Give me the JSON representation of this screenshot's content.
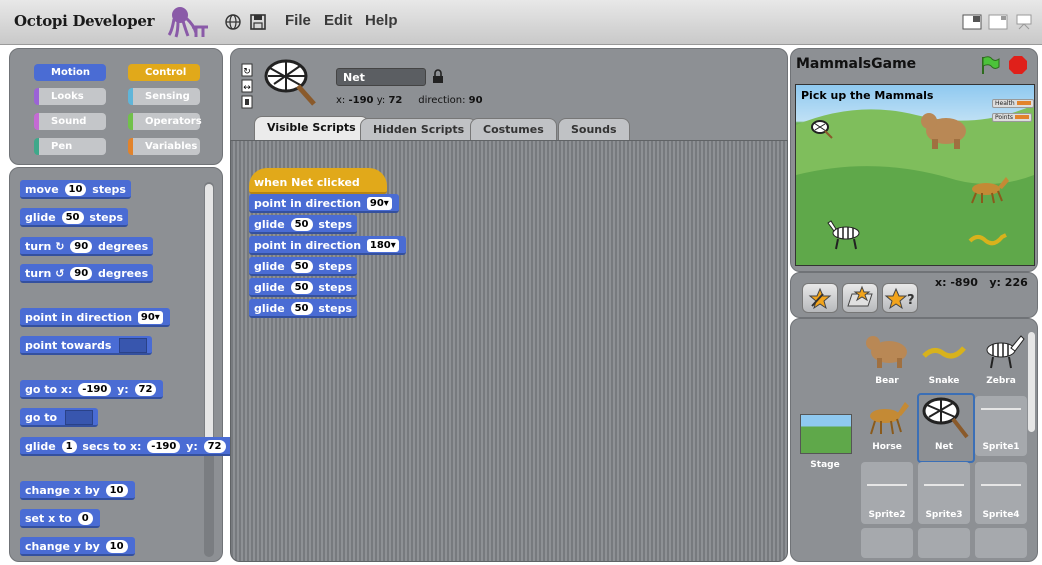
{
  "app": {
    "title": "Octopi Developer",
    "menus": [
      "File",
      "Edit",
      "Help"
    ]
  },
  "categories": [
    {
      "label": "Motion",
      "active": true
    },
    {
      "label": "Control"
    },
    {
      "label": "Looks"
    },
    {
      "label": "Sensing"
    },
    {
      "label": "Sound"
    },
    {
      "label": "Operators"
    },
    {
      "label": "Pen"
    },
    {
      "label": "Variables"
    }
  ],
  "palette": {
    "move": {
      "label": "move",
      "value": "10",
      "suffix": "steps"
    },
    "glide": {
      "label": "glide",
      "value": "50",
      "suffix": "steps"
    },
    "turn_cw": {
      "label": "turn",
      "value": "90",
      "suffix": "degrees"
    },
    "turn_ccw": {
      "label": "turn",
      "value": "90",
      "suffix": "degrees"
    },
    "point_dir": {
      "label": "point in direction",
      "value": "90"
    },
    "point_towards": {
      "label": "point towards"
    },
    "goto_xy": {
      "label": "go to x:",
      "x": "-190",
      "ylabel": "y:",
      "y": "72"
    },
    "goto": {
      "label": "go to"
    },
    "glide_secs": {
      "label": "glide",
      "secs": "1",
      "mid": "secs to x:",
      "x": "-190",
      "ylabel": "y:",
      "y": "72"
    },
    "change_x": {
      "label": "change x by",
      "value": "10"
    },
    "set_x": {
      "label": "set x to",
      "value": "0"
    },
    "change_y": {
      "label": "change y by",
      "value": "10"
    }
  },
  "sprite": {
    "name": "Net",
    "x_label": "x:",
    "x": "-190",
    "y_label": "y:",
    "y": "72",
    "direction_label": "direction:",
    "direction": "90"
  },
  "tabs": [
    "Visible Scripts",
    "Hidden Scripts",
    "Costumes",
    "Sounds"
  ],
  "script": {
    "hat": "when Net clicked",
    "blocks": [
      {
        "label": "point in direction",
        "value": "90",
        "dropdown": true
      },
      {
        "label": "glide",
        "value": "50",
        "suffix": "steps"
      },
      {
        "label": "point in direction",
        "value": "180",
        "dropdown": true
      },
      {
        "label": "glide",
        "value": "50",
        "suffix": "steps"
      },
      {
        "label": "glide",
        "value": "50",
        "suffix": "steps"
      },
      {
        "label": "glide",
        "value": "50",
        "suffix": "steps"
      }
    ]
  },
  "stage": {
    "title": "MammalsGame",
    "heading": "Pick up the Mammals",
    "monitors": [
      "Health",
      "Points"
    ],
    "mouse_x_label": "x:",
    "mouse_x": "-890",
    "mouse_y_label": "y:",
    "mouse_y": "226"
  },
  "sprites": [
    {
      "name": "Bear"
    },
    {
      "name": "Snake"
    },
    {
      "name": "Zebra"
    },
    {
      "name": "Horse"
    },
    {
      "name": "Net",
      "selected": true
    },
    {
      "name": "Sprite1"
    },
    {
      "name": "Sprite2"
    },
    {
      "name": "Sprite3"
    },
    {
      "name": "Sprite4"
    }
  ],
  "stage_thumb_label": "Stage",
  "colors": {
    "motion": "#4a6cd4",
    "control": "#e1a91a",
    "panel": "#8d9094"
  }
}
